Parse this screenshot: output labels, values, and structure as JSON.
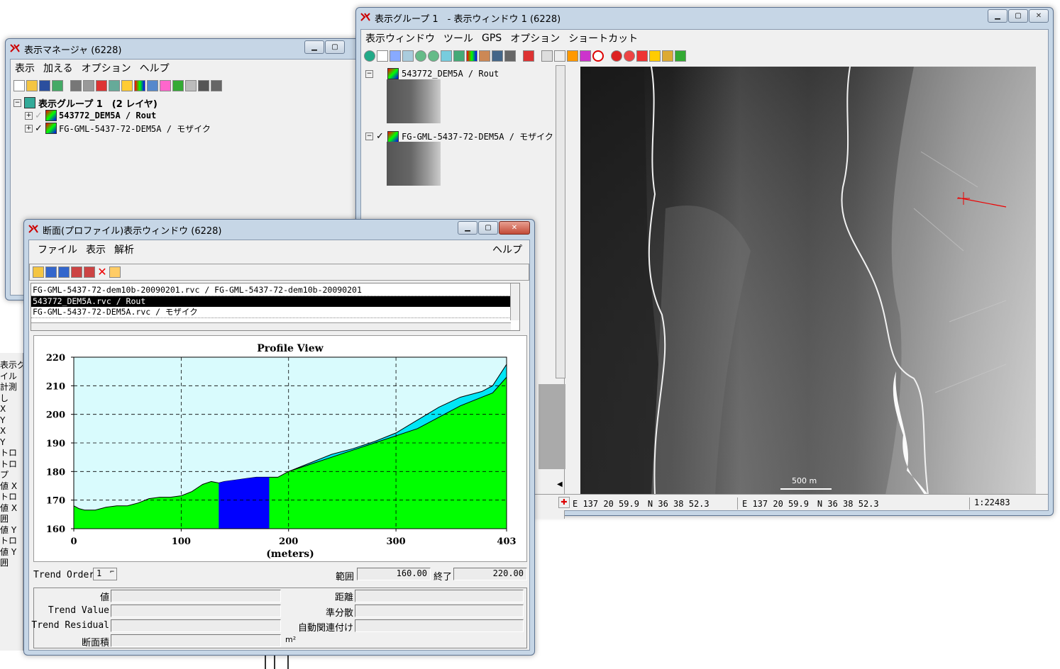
{
  "display_manager": {
    "title": "表示マネージャ (6228)",
    "menu": [
      "表示",
      "加える",
      "オプション",
      "ヘルプ"
    ],
    "group_label": "表示グループ 1　(2 レイヤ)",
    "layers": [
      {
        "label": "543772_DEM5A / Rout",
        "checked": false
      },
      {
        "label": "FG-GML-5437-72-DEM5A / モザイク",
        "checked": true
      }
    ]
  },
  "view_window": {
    "title": "表示グループ 1　- 表示ウィンドウ 1 (6228)",
    "menu": [
      "表示ウィンドウ",
      "ツール",
      "GPS",
      "オプション",
      "ショートカット"
    ],
    "layers": [
      {
        "label": "543772_DEM5A / Rout",
        "checked": false
      },
      {
        "label": "FG-GML-5437-72-DEM5A / モザイク",
        "checked": true
      }
    ],
    "scale_bar_label": "500 m",
    "status_coord_1": "E 137 20 59.9　N 36 38 52.3",
    "status_coord_2": "E 137 20 59.9　N 36 38 52.3",
    "status_scale": "1:22483"
  },
  "profile_window": {
    "title": "断面(プロファイル)表示ウィンドウ (6228)",
    "menu": [
      "ファイル",
      "表示",
      "解析"
    ],
    "menu_help": "ヘルプ",
    "list_items": [
      "FG-GML-5437-72-dem10b-20090201.rvc / FG-GML-5437-72-dem10b-20090201",
      "543772_DEM5A.rvc / Rout",
      "FG-GML-5437-72-DEM5A.rvc / モザイク"
    ],
    "selected_index": 1,
    "trend_order_label": "Trend Order",
    "trend_order_value": "1",
    "range_label": "範囲",
    "range_start": "160.00",
    "end_label": "終了",
    "range_end": "220.00",
    "stats_left_labels": [
      "値",
      "Trend Value",
      "Trend Residual",
      "断面積"
    ],
    "stats_right_labels": [
      "距離",
      "準分散",
      "自動関連付け"
    ],
    "area_unit": "m²"
  },
  "background_window": {
    "fragments": [
      "表示グル",
      "イル",
      "計測",
      "し",
      "X",
      "Y",
      "X",
      "Y",
      "トロ",
      "トロ",
      "プ",
      "値 X",
      "トロ",
      "値 X",
      "囲",
      "値 Y",
      "トロ",
      "値 Y",
      "囲"
    ]
  },
  "chart_data": {
    "type": "area",
    "title": "Profile View",
    "xlabel": "(meters)",
    "ylabel": "",
    "xlim": [
      0,
      403
    ],
    "ylim": [
      160,
      220
    ],
    "x_ticks": [
      "0",
      "100",
      "200",
      "300",
      "403"
    ],
    "y_ticks": [
      "160",
      "170",
      "180",
      "190",
      "200",
      "210",
      "220"
    ],
    "grid": true,
    "colors": {
      "background": "#d9fbfd",
      "terrain": "#00ff00",
      "upper": "#00e6f5",
      "selection": "#0000ff"
    },
    "series": [
      {
        "x": [
          0,
          5,
          10,
          20,
          30,
          40,
          50,
          60,
          70,
          80,
          90,
          100,
          110,
          120,
          128,
          135,
          140,
          150,
          160,
          170,
          180,
          190,
          200,
          220,
          240,
          260,
          280,
          300,
          320,
          340,
          360,
          380,
          390,
          403
        ],
        "values": [
          168,
          167,
          166.5,
          166.5,
          167.5,
          168,
          168,
          169,
          170.5,
          171,
          171,
          171.5,
          173,
          175.5,
          176.5,
          176,
          176.5,
          177,
          177.5,
          178,
          178,
          178,
          180,
          182.5,
          185,
          187.5,
          190,
          192.5,
          195,
          199,
          203,
          206,
          207.5,
          213
        ]
      },
      {
        "x": [
          200,
          220,
          240,
          260,
          280,
          300,
          320,
          340,
          360,
          380,
          390,
          403
        ],
        "values": [
          180,
          183,
          186,
          188,
          190.5,
          193.5,
          198,
          202.5,
          206,
          208,
          210,
          217.5
        ]
      }
    ],
    "selection_range": [
      135,
      182
    ]
  }
}
